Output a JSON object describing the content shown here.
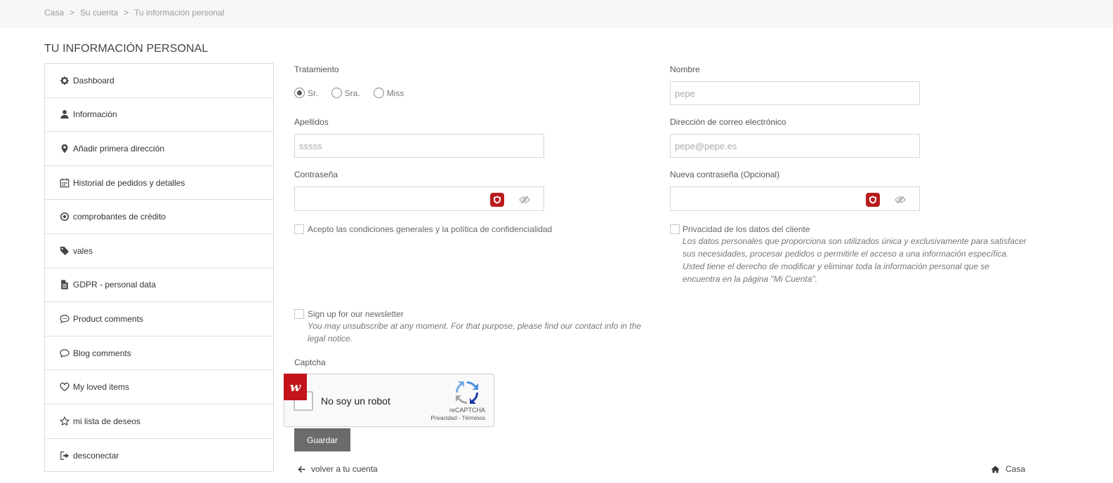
{
  "breadcrumb": {
    "items": [
      "Casa",
      "Su cuenta",
      "Tu información personal"
    ],
    "separator": ">"
  },
  "page_title": "TU INFORMACIÓN PERSONAL",
  "sidebar": {
    "items": [
      {
        "label": "Dashboard",
        "icon": "gear-icon"
      },
      {
        "label": "Información",
        "icon": "user-icon"
      },
      {
        "label": "Añadir primera dirección",
        "icon": "map-pin-icon"
      },
      {
        "label": "Historial de pedidos y detalles",
        "icon": "calendar-icon"
      },
      {
        "label": "comprobantes de crédito",
        "icon": "dot-circle-icon"
      },
      {
        "label": "vales",
        "icon": "tag-icon"
      },
      {
        "label": "GDPR - personal data",
        "icon": "document-icon"
      },
      {
        "label": "Product comments",
        "icon": "comments-icon"
      },
      {
        "label": "Blog comments",
        "icon": "comment-icon"
      },
      {
        "label": "My loved items",
        "icon": "heart-icon"
      },
      {
        "label": "mi lista de deseos",
        "icon": "star-icon"
      },
      {
        "label": "desconectar",
        "icon": "sign-out-icon"
      }
    ]
  },
  "form": {
    "tratamiento_label": "Tratamiento",
    "tratamiento_options": [
      {
        "label": "Sr.",
        "checked": true
      },
      {
        "label": "Sra.",
        "checked": false
      },
      {
        "label": "Miss",
        "checked": false
      }
    ],
    "nombre_label": "Nombre",
    "nombre_placeholder": "pepe",
    "apellidos_label": "Apellidos",
    "apellidos_placeholder": "sssss",
    "email_label": "Dirección de correo electrónico",
    "email_placeholder": "pepe@pepe.es",
    "password_label": "Contraseña",
    "new_password_label": "Nueva contraseña (Opcional)",
    "terms_label": "Acepto las condiciones generales y la política de confidencialidad",
    "privacy_label": "Privacidad de los datos del cliente",
    "privacy_note": "Los datos personales que proporciona son utilizados única y exclusivamente para satisfacer sus necesidades, procesar pedidos o permitirle el acceso a una información específica. Usted tiene el derecho de modificar y eliminar toda la información personal que se encuentra en la página \"Mi Cuenta\".",
    "newsletter_label": "Sign up for our newsletter",
    "newsletter_note": "You may unsubscribe at any moment. For that purpose, please find our contact info in the legal notice.",
    "captcha_label": "Captcha",
    "captcha_text": "No soy un robot",
    "captcha_brand": "reCAPTCHA",
    "captcha_links": "Privacidad - Términos",
    "badge_text": "w",
    "save_label": "Guardar"
  },
  "footer": {
    "back_label": "volver a tu cuenta",
    "home_label": "Casa"
  },
  "colors": {
    "button_bg": "#6b6b6b",
    "brand_red": "#c4141b"
  }
}
